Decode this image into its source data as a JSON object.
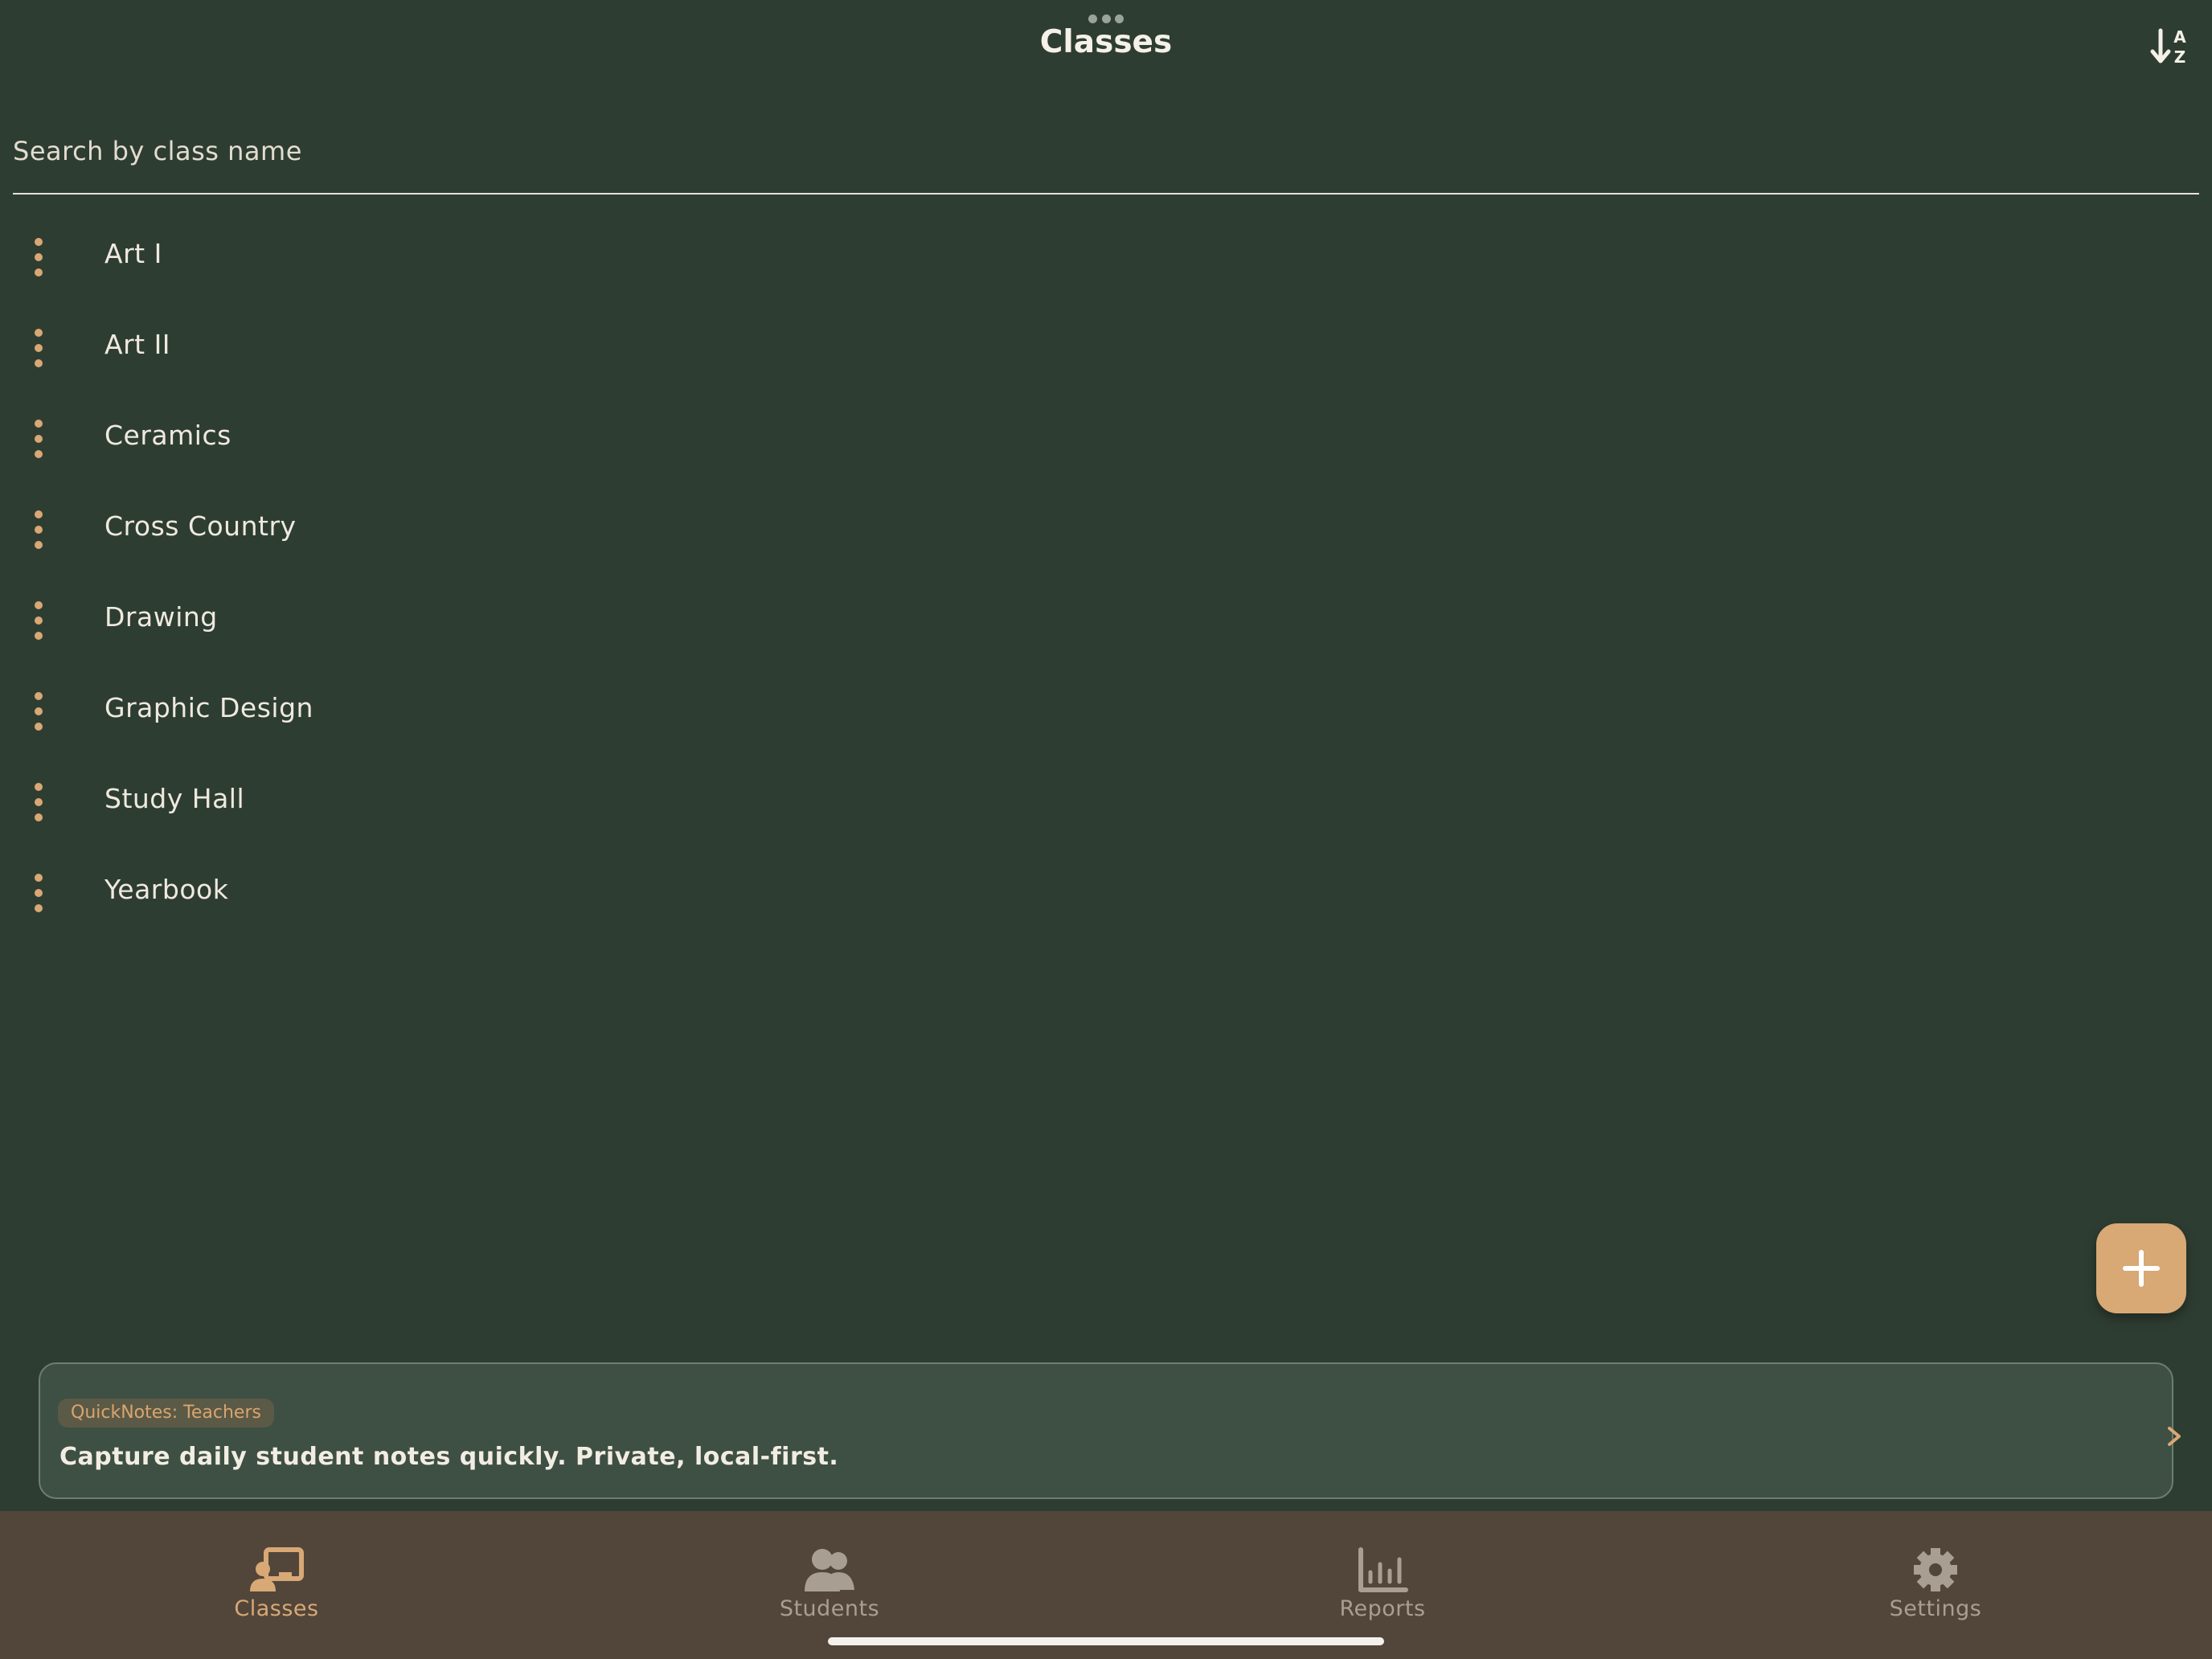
{
  "header": {
    "title": "Classes",
    "sort_icon": "sort-alpha-down-icon"
  },
  "search": {
    "placeholder": "Search by class name",
    "value": ""
  },
  "classes": [
    {
      "name": "Art I"
    },
    {
      "name": "Art II"
    },
    {
      "name": "Ceramics"
    },
    {
      "name": "Cross Country"
    },
    {
      "name": "Drawing"
    },
    {
      "name": "Graphic Design"
    },
    {
      "name": "Study Hall"
    },
    {
      "name": "Yearbook"
    }
  ],
  "fab": {
    "icon": "plus-icon"
  },
  "promo": {
    "badge": "QuickNotes: Teachers",
    "text": "Capture daily student notes quickly. Private, local-first."
  },
  "tabs": [
    {
      "label": "Classes",
      "icon": "classroom-icon",
      "active": true
    },
    {
      "label": "Students",
      "icon": "people-icon",
      "active": false
    },
    {
      "label": "Reports",
      "icon": "bar-chart-icon",
      "active": false
    },
    {
      "label": "Settings",
      "icon": "gear-icon",
      "active": false
    }
  ],
  "colors": {
    "background": "#2e3d32",
    "accent": "#d8a875",
    "tabbar": "#52463a",
    "promo_background": "#3e4f43",
    "inactive_tab": "#a89e91"
  }
}
